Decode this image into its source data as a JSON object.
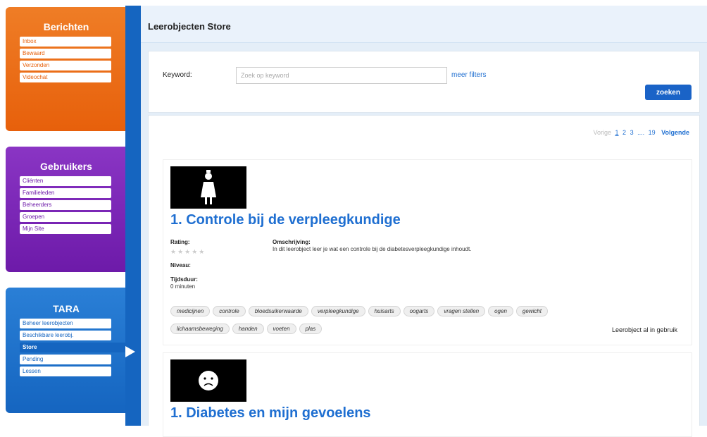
{
  "sidebar": {
    "berichten": {
      "title": "Berichten",
      "items": [
        "Inbox",
        "Bewaard",
        "Verzonden",
        "Videochat"
      ]
    },
    "gebruikers": {
      "title": "Gebruikers",
      "items": [
        "Cliënten",
        "Familieleden",
        "Beheerders",
        "Groepen",
        "Mijn Site"
      ]
    },
    "tara": {
      "title": "TARA",
      "items": [
        "Beheer leerobjecten",
        "Beschikbare leerobj.",
        "Store",
        "Pending",
        "Lessen"
      ]
    }
  },
  "header": {
    "title": "Leerobjecten Store"
  },
  "search": {
    "keyword_label": "Keyword:",
    "placeholder": "Zoek op keyword",
    "more_filters": "meer filters",
    "button": "zoeken"
  },
  "pager": {
    "prev": "Vorige",
    "p1": "1",
    "p2": "2",
    "p3": "3",
    "ellipsis": "....",
    "last": "19",
    "next": "Volgende"
  },
  "items": [
    {
      "title": "1. Controle bij de verpleegkundige",
      "rating_label": "Rating:",
      "description_label": "Omschrijving:",
      "description": "In dit leerobject leer je wat een controle bij de diabetesverpleegkundige inhoudt.",
      "level_label": "Niveau:",
      "duration_label": "Tijdsduur:",
      "duration": "0 minuten",
      "tags": [
        "medicijnen",
        "controle",
        "bloedsuikerwaarde",
        "verpleegkundige",
        "huisarts",
        "oogarts",
        "vragen stellen",
        "ogen",
        "gewicht",
        "lichaamsbeweging",
        "handen",
        "voeten",
        "plas"
      ],
      "status": "Leerobject al in gebruik",
      "thumb_icon": "nurse-icon"
    },
    {
      "title": "1. Diabetes en mijn gevoelens",
      "thumb_icon": "sad-face-icon"
    }
  ],
  "colors": {
    "orange": "#e7600b",
    "purple": "#6d1aa9",
    "blue": "#1565c0",
    "link": "#1f6fd1"
  }
}
